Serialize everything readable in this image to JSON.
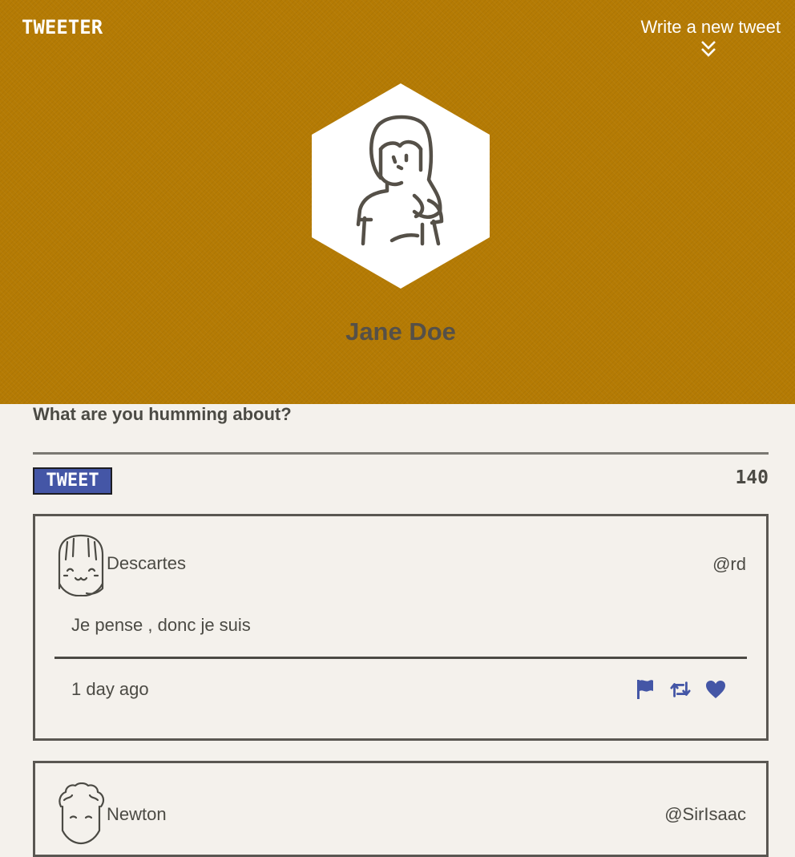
{
  "header": {
    "brand": "TWEETER",
    "compose_toggle": "Write a new tweet",
    "profile_name": "Jane Doe"
  },
  "compose": {
    "placeholder": "What are you humming about?",
    "button_label": "TWEET",
    "counter": "140"
  },
  "tweets": [
    {
      "name": "Descartes",
      "handle": "@rd",
      "text": "Je pense , donc je suis",
      "time": "1 day ago",
      "actions": [
        "flag-icon",
        "retweet-icon",
        "heart-icon"
      ]
    },
    {
      "name": "Newton",
      "handle": "@SirIsaac"
    }
  ],
  "colors": {
    "header_bg": "#b57b04",
    "page_bg": "#f4f1ec",
    "accent": "#4456a6",
    "text": "#4b4a44"
  }
}
